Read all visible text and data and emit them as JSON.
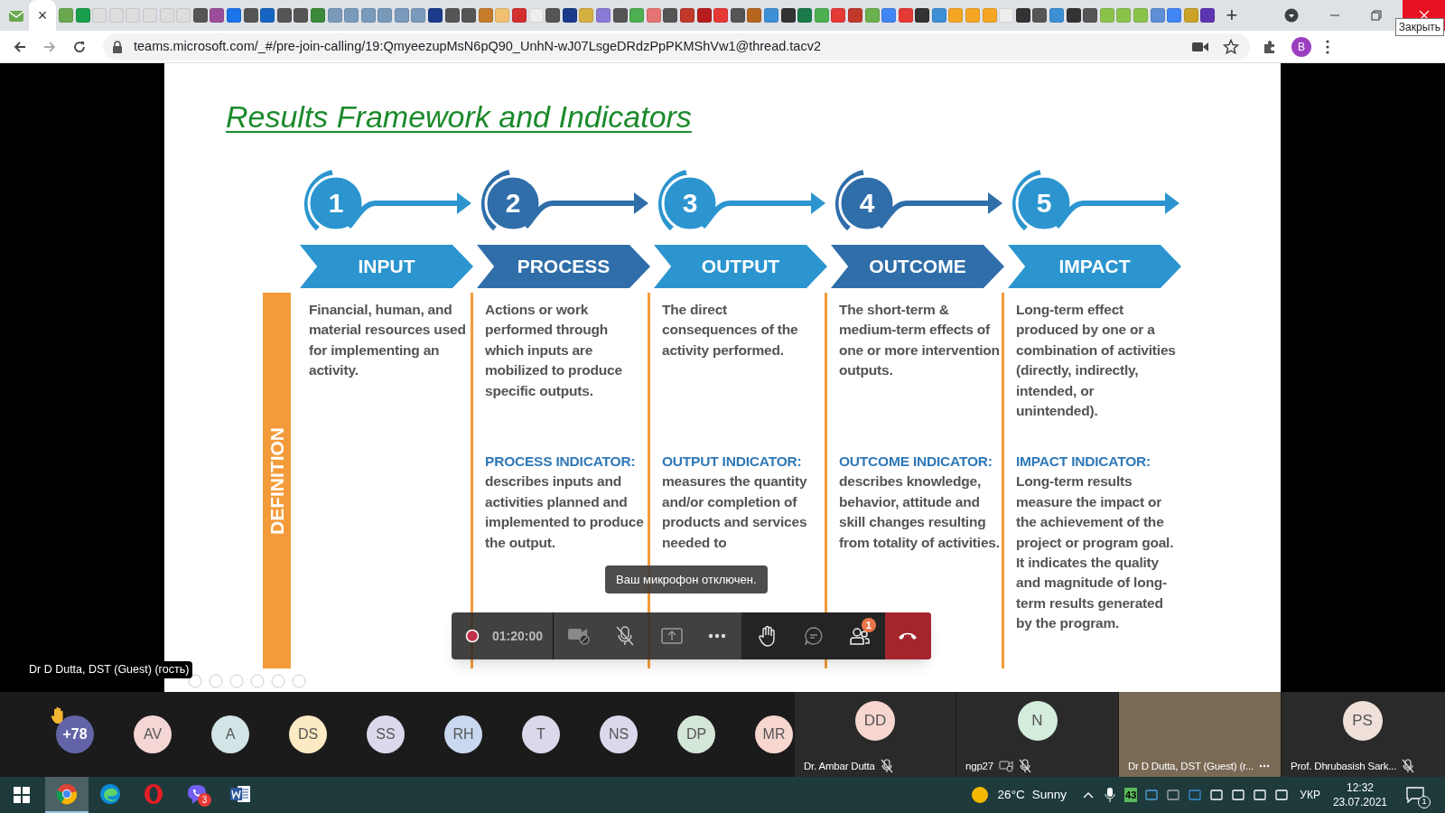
{
  "browser": {
    "close_tab": "×",
    "new_tab": "+",
    "close_tooltip": "Закрыть",
    "url": "teams.microsoft.com/_#/pre-join-calling/19:QmyeezupMsN6pQ90_UnhN-wJ07LsgeDRdzPpPKMShVw1@thread.tacv2",
    "profile": "B"
  },
  "slide": {
    "title": "Results Framework and Indicators",
    "side_label": "DEFINITION",
    "stages": [
      {
        "number": "1",
        "label": "INPUT",
        "definition": "Financial, human, and material resources used for implementing an activity."
      },
      {
        "number": "2",
        "label": "PROCESS",
        "definition": "Actions or work performed through which inputs are mobilized to produce specific outputs.",
        "indicator_title": "PROCESS INDICATOR:",
        "indicator": "describes inputs and activities planned and implemented to produce the output."
      },
      {
        "number": "3",
        "label": "OUTPUT",
        "definition": "The direct consequences of the activity performed.",
        "indicator_title": "OUTPUT INDICATOR:",
        "indicator": "measures the quantity and/or completion of products and services needed to"
      },
      {
        "number": "4",
        "label": "OUTCOME",
        "definition": "The short-term & medium-term effects of one or more intervention outputs.",
        "indicator_title": "OUTCOME INDICATOR:",
        "indicator": "describes knowledge, behavior, attitude and skill changes resulting from totality of activities."
      },
      {
        "number": "5",
        "label": "IMPACT",
        "definition": "Long-term effect produced by one or a combination of activities (directly, indirectly, intended, or unintended).",
        "indicator_title": "IMPACT INDICATOR:",
        "indicator": "Long-term results measure the impact or the achievement of the project or program goal. It indicates the quality and magnitude of long-term results generated by the program."
      }
    ]
  },
  "presenter_label": "Dr D Dutta, DST (Guest) (гость)",
  "call_controls": {
    "timer": "01:20:00",
    "camera_off": true,
    "mic_muted": true,
    "people_badge": "1",
    "tooltip": "Ваш микрофон отключен."
  },
  "participants": {
    "overflow": {
      "count": "+78",
      "hand_raised": true
    },
    "avatars": [
      {
        "initials": "AV",
        "color": "#f4d6d4"
      },
      {
        "initials": "A",
        "color": "#d3e4e6"
      },
      {
        "initials": "DS",
        "color": "#fbeac2"
      },
      {
        "initials": "SS",
        "color": "#dcd8ec"
      },
      {
        "initials": "RH",
        "color": "#c9d8ee"
      },
      {
        "initials": "T",
        "color": "#dcd8ec"
      },
      {
        "initials": "NS",
        "color": "#dcd8ec"
      },
      {
        "initials": "DP",
        "color": "#d3e6d8"
      },
      {
        "initials": "MR",
        "color": "#f6d6cf"
      }
    ],
    "tiles": [
      {
        "kind": "avatar",
        "initials": "DD",
        "color": "#f6d6cf",
        "name": "Dr. Ambar Dutta",
        "muted": true
      },
      {
        "kind": "avatar",
        "initials": "N",
        "color": "#d3ecdc",
        "name": "ngp27",
        "camera_off": true,
        "muted": true
      },
      {
        "kind": "video",
        "name": "Dr D Dutta, DST (Guest) (r..."
      },
      {
        "kind": "avatar",
        "initials": "PS",
        "color": "#efe0da",
        "name": "Prof. Dhrubasish Sark...",
        "muted": true
      }
    ]
  },
  "taskbar": {
    "apps": [
      {
        "kind": "chrome",
        "active": true
      },
      {
        "kind": "edge",
        "active": false
      },
      {
        "kind": "opera",
        "active": false
      },
      {
        "kind": "viber",
        "active": false,
        "badge": "3"
      },
      {
        "kind": "word",
        "active": false
      }
    ],
    "temperature": "26°C",
    "weather": "Sunny",
    "tray_badge": "43",
    "language": "УКР",
    "time": "12:32",
    "date": "23.07.2021",
    "notifications": "1"
  }
}
